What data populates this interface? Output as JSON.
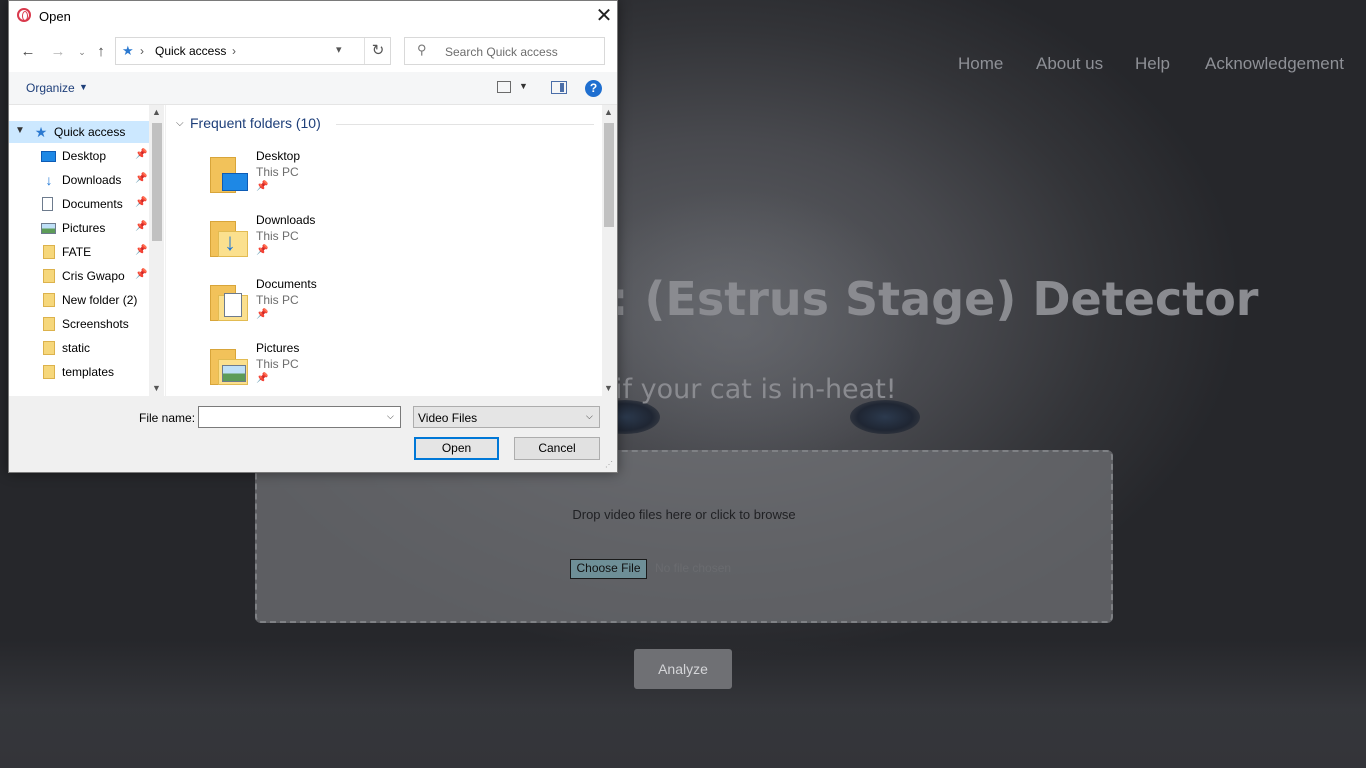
{
  "webpage": {
    "nav": [
      "Home",
      "About us",
      "Help",
      "Acknowledgement"
    ],
    "title_visible": ": (Estrus Stage) Detector",
    "subtitle_visible": "if your cat is in-heat!",
    "dropzone_text": "Drop video files here or click to browse",
    "choose_file_label": "Choose File",
    "no_file_text": "No file chosen",
    "analyze_label": "Analyze"
  },
  "dialog": {
    "title": "Open",
    "address": {
      "location": "Quick access"
    },
    "search": {
      "placeholder": "Search Quick access"
    },
    "organize_label": "Organize",
    "help_glyph": "?",
    "nav_pane": [
      {
        "label": "Quick access",
        "icon": "star-icon",
        "pinned": false,
        "selected": true
      },
      {
        "label": "Desktop",
        "icon": "desktop-icon",
        "pinned": true
      },
      {
        "label": "Downloads",
        "icon": "download-arrow-icon",
        "pinned": true
      },
      {
        "label": "Documents",
        "icon": "document-icon",
        "pinned": true
      },
      {
        "label": "Pictures",
        "icon": "picture-icon",
        "pinned": true
      },
      {
        "label": "FATE",
        "icon": "folder-icon",
        "pinned": true
      },
      {
        "label": "Cris Gwapo",
        "icon": "folder-icon",
        "pinned": true
      },
      {
        "label": "New folder (2)",
        "icon": "folder-icon",
        "pinned": false
      },
      {
        "label": "Screenshots",
        "icon": "folder-icon",
        "pinned": false
      },
      {
        "label": "static",
        "icon": "folder-icon",
        "pinned": false
      },
      {
        "label": "templates",
        "icon": "folder-icon",
        "pinned": false
      }
    ],
    "group_header": "Frequent folders (10)",
    "folders": [
      {
        "name": "Desktop",
        "location": "This PC"
      },
      {
        "name": "Downloads",
        "location": "This PC"
      },
      {
        "name": "Documents",
        "location": "This PC"
      },
      {
        "name": "Pictures",
        "location": "This PC"
      }
    ],
    "file_name_label": "File name:",
    "file_name_value": "",
    "file_type": "Video Files",
    "open_label": "Open",
    "cancel_label": "Cancel"
  },
  "colors": {
    "accent": "#0078d7",
    "link_blue": "#1e3f7a",
    "selected_bg": "#cce8ff"
  }
}
